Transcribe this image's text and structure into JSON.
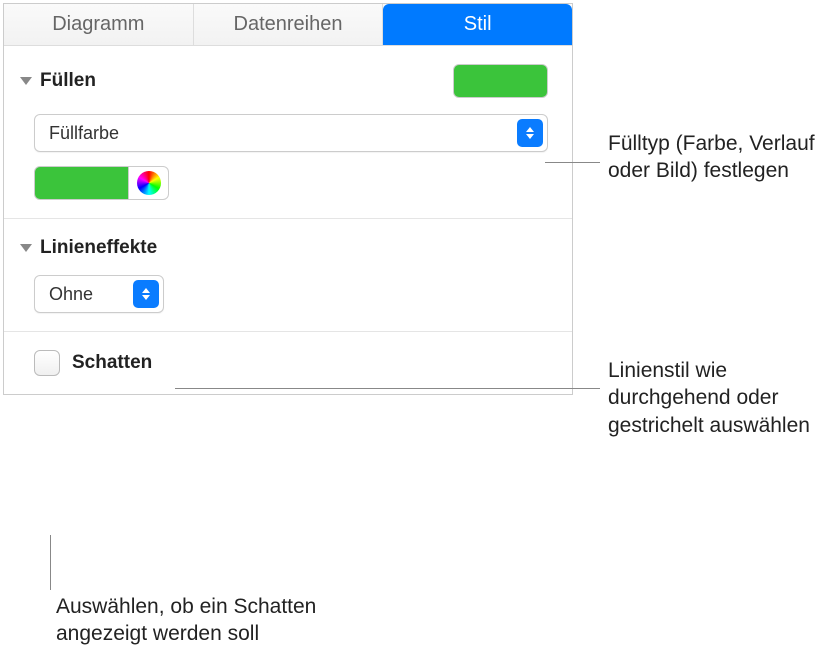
{
  "tabs": {
    "diagram": "Diagramm",
    "series": "Datenreihen",
    "style": "Stil"
  },
  "fill": {
    "title": "Füllen",
    "popup_value": "Füllfarbe",
    "swatch_color": "#3bc43b"
  },
  "line_effects": {
    "title": "Linieneffekte",
    "popup_value": "Ohne"
  },
  "shadow": {
    "label": "Schatten"
  },
  "callouts": {
    "fill_type": "Fülltyp (Farbe, Verlauf oder Bild) festlegen",
    "line_style": "Linienstil wie durchgehend oder gestrichelt auswählen",
    "shadow": "Auswählen, ob ein Schatten angezeigt werden soll"
  }
}
